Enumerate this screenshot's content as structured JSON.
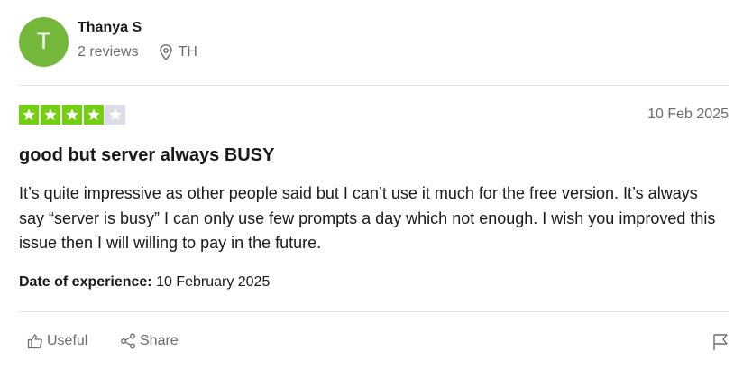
{
  "reviewer": {
    "avatar_initial": "T",
    "avatar_color": "#73b73b",
    "name": "Thanya S",
    "reviews_count": "2 reviews",
    "location": "TH"
  },
  "review": {
    "rating": 4,
    "max_rating": 5,
    "star_filled_color": "#73cf11",
    "star_empty_color": "#dcdce6",
    "date": "10 Feb 2025",
    "title": "good but server always BUSY",
    "body": "It’s quite impressive as other people said but I can’t use it much for the free version. It’s always say “server is busy” I can only use few prompts a day which not enough. I wish you improved this issue then I will willing to pay in the future.",
    "experience_label": "Date of experience:",
    "experience_date": "10 February 2025"
  },
  "actions": {
    "useful_label": "Useful",
    "useful_icon": "thumbs-up-icon",
    "share_label": "Share",
    "share_icon": "share-icon",
    "report_icon": "flag-icon"
  }
}
